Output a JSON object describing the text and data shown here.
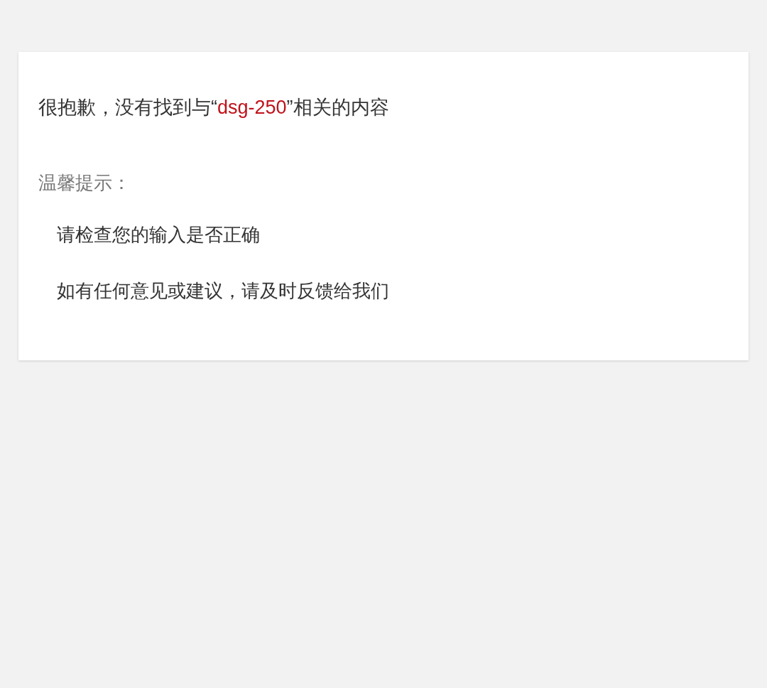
{
  "result_message": {
    "before": "很抱歉，没有找到与“",
    "query": "dsg-250",
    "after": "”相关的内容"
  },
  "tips": {
    "title": "温馨提示：",
    "items": [
      "请检查您的输入是否正确",
      "如有任何意见或建议，请及时反馈给我们"
    ]
  }
}
